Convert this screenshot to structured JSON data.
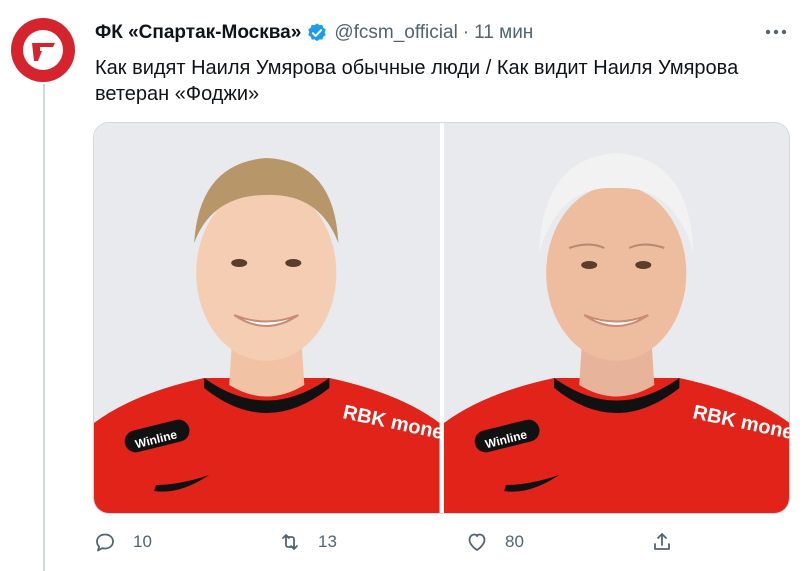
{
  "account": {
    "name": "ФК «Спартак-Москва»",
    "handle": "@fcsm_official",
    "separator": "·",
    "time": "11 мин",
    "avatar_icon": "spartak-logo-icon",
    "brand_color": "#d6242f",
    "verified_color": "#1d9bf0"
  },
  "tweet": {
    "text_line1": "Как видят Наиля Умярова обычные люди / Как видит Наиля Умярова",
    "text_line2": "ветеран «Фоджи»"
  },
  "media": {
    "left_photo": {
      "sponsor_badge": "Winline",
      "shirt_sponsor": "RBK money",
      "subject": "young-player-photo"
    },
    "right_photo": {
      "sponsor_badge": "Winline",
      "shirt_sponsor": "RBK money",
      "subject": "aged-player-photo"
    }
  },
  "actions": {
    "reply_count": "10",
    "retweet_count": "13",
    "like_count": "80",
    "reply_icon": "reply-icon",
    "retweet_icon": "retweet-icon",
    "like_icon": "heart-icon",
    "share_icon": "share-icon"
  },
  "more_icon": "more-icon"
}
